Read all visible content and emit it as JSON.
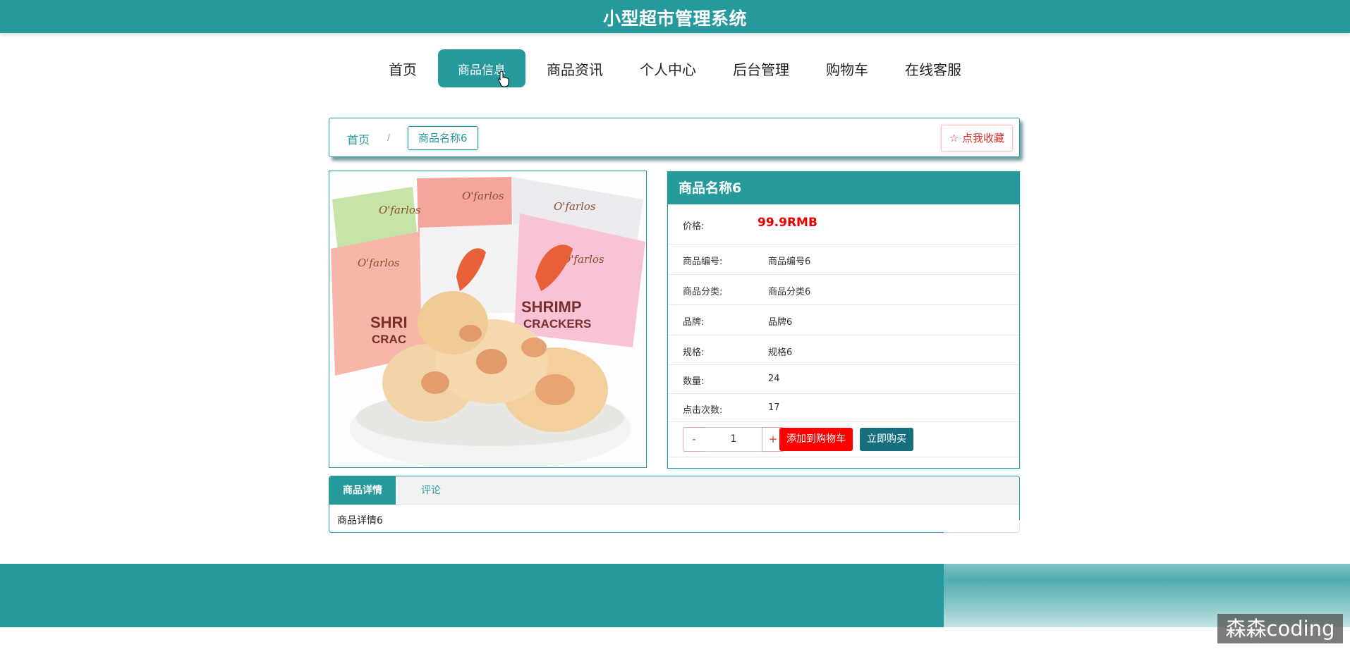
{
  "site_title": "小型超市管理系统",
  "nav": {
    "items": [
      "首页",
      "商品信息",
      "商品资讯",
      "个人中心",
      "后台管理",
      "购物车",
      "在线客服"
    ],
    "active": "商品信息"
  },
  "breadcrumb": {
    "home": "首页",
    "separator": "/",
    "current": "商品名称6"
  },
  "favorite": {
    "icon": "star-outline-icon",
    "label": "点我收藏"
  },
  "product": {
    "name": "商品名称6",
    "price_label": "价格:",
    "price": "99.9RMB",
    "fields": [
      {
        "label": "商品编号:",
        "value": "商品编号6"
      },
      {
        "label": "商品分类:",
        "value": "商品分类6"
      },
      {
        "label": "品牌:",
        "value": "品牌6"
      },
      {
        "label": "规格:",
        "value": "规格6"
      },
      {
        "label": "数量:",
        "value": "24"
      },
      {
        "label": "点击次数:",
        "value": "17"
      }
    ],
    "image_alt": "SHRIMP CRACKERS",
    "packet_text": "SHRIMP CRACKERS"
  },
  "quantity": {
    "minus": "-",
    "value": "1",
    "plus": "+"
  },
  "buttons": {
    "add_cart": "添加到购物车",
    "buy_now": "立即购买"
  },
  "tabs": {
    "detail": "商品详情",
    "comment": "评论",
    "content": "商品详情6"
  },
  "watermark": "森森coding",
  "colors": {
    "primary": "#26999c",
    "price": "#e60000",
    "add_cart": "#ff0000",
    "buy": "#176f7d"
  }
}
